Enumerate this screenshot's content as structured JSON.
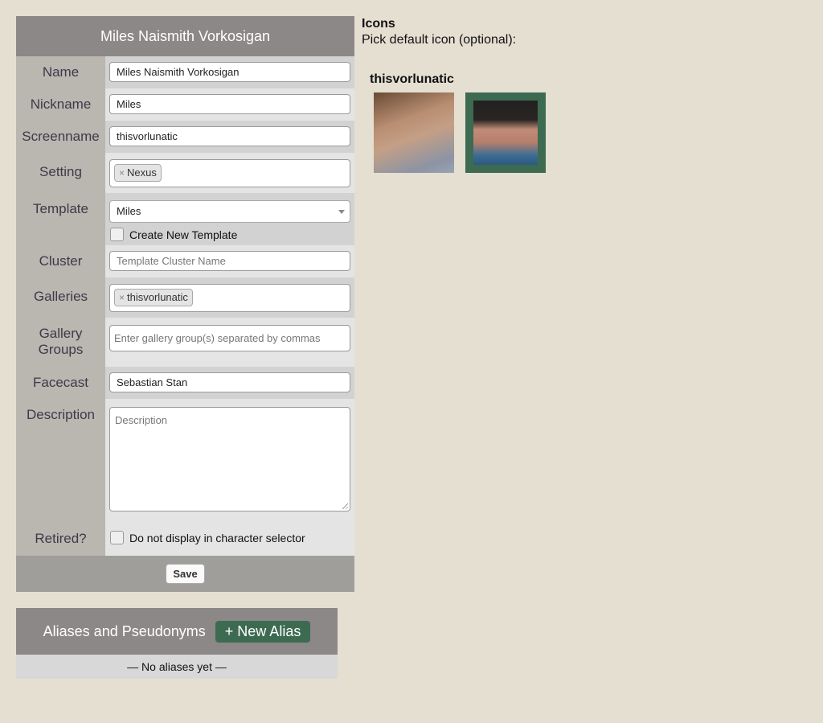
{
  "form": {
    "title": "Miles Naismith Vorkosigan",
    "fields": {
      "name": {
        "label": "Name",
        "value": "Miles Naismith Vorkosigan"
      },
      "nickname": {
        "label": "Nickname",
        "value": "Miles"
      },
      "screenname": {
        "label": "Screenname",
        "value": "thisvorlunatic"
      },
      "setting": {
        "label": "Setting",
        "tag": "Nexus"
      },
      "template": {
        "label": "Template",
        "value": "Miles",
        "create_label": "Create New Template"
      },
      "cluster": {
        "label": "Cluster",
        "placeholder": "Template Cluster Name"
      },
      "galleries": {
        "label": "Galleries",
        "tag": "thisvorlunatic"
      },
      "gallery_groups": {
        "label": "Gallery Groups",
        "placeholder": "Enter gallery group(s) separated by commas"
      },
      "facecast": {
        "label": "Facecast",
        "value": "Sebastian Stan"
      },
      "description": {
        "label": "Description",
        "placeholder": "Description"
      },
      "retired": {
        "label": "Retired?",
        "checkbox_label": "Do not display in character selector"
      }
    },
    "save_label": "Save"
  },
  "aliases": {
    "title": "Aliases and Pseudonyms",
    "new_button": "+ New Alias",
    "empty": "— No aliases yet —"
  },
  "icons": {
    "title": "Icons",
    "subtitle": "Pick default icon (optional):",
    "gallery_name": "thisvorlunatic",
    "selected_color": "#3d6b52"
  },
  "tag_remove": "×"
}
